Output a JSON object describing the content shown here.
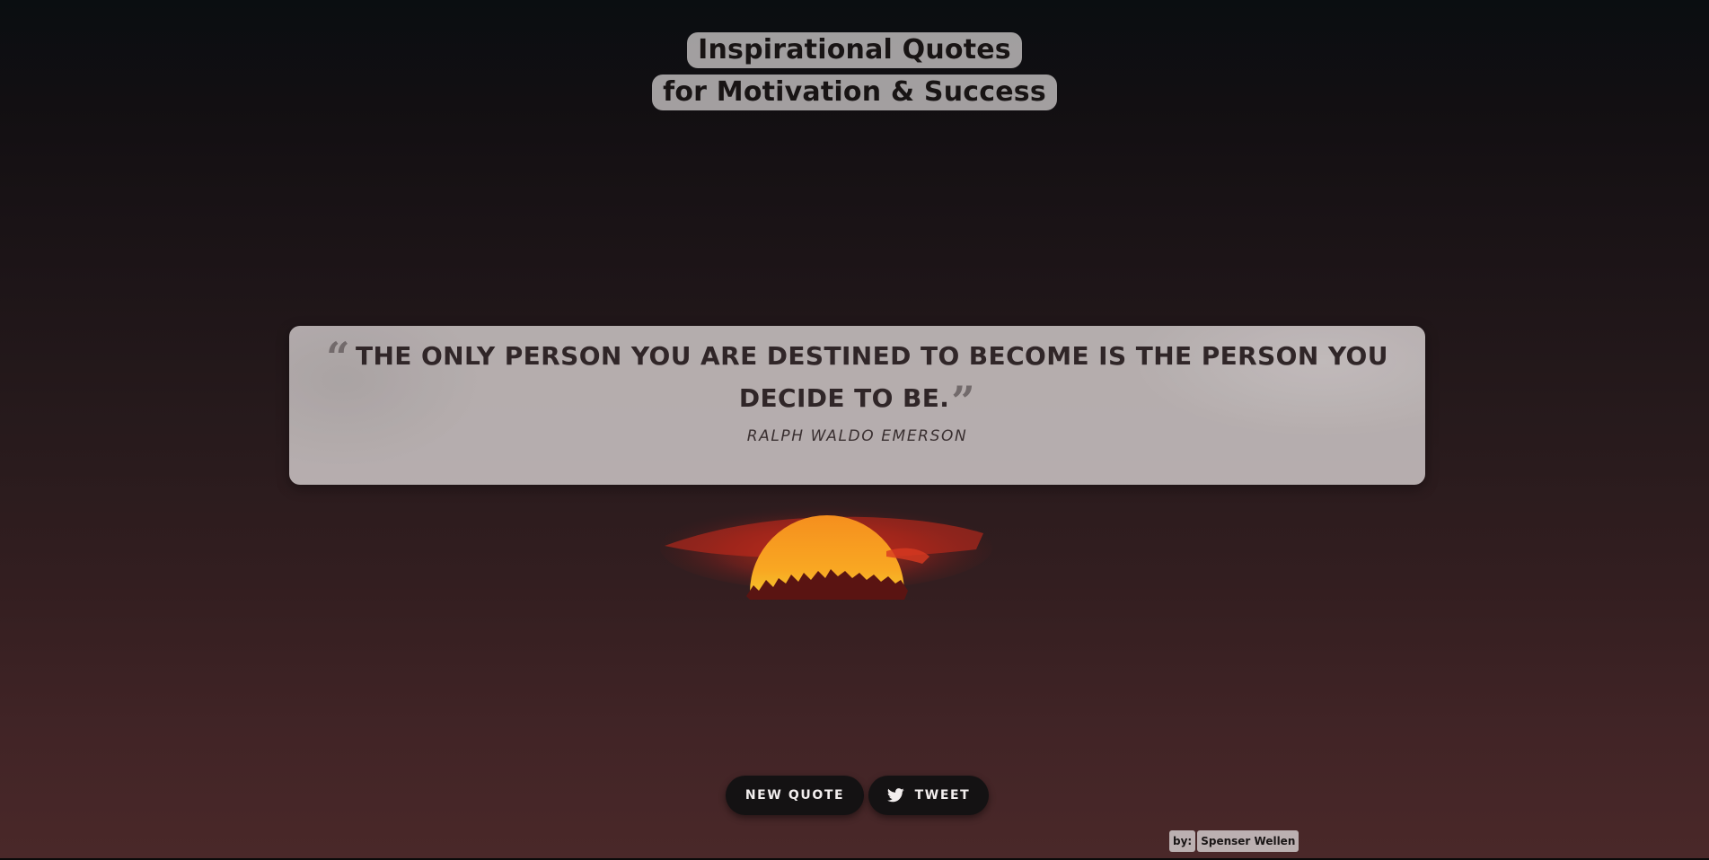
{
  "header": {
    "title_line1": "Inspirational Quotes",
    "title_line2": "for Motivation & Success"
  },
  "quote": {
    "text": "THE ONLY PERSON YOU ARE DESTINED TO BECOME IS THE PERSON YOU DECIDE TO BE.",
    "open_mark": "“",
    "close_mark": "”",
    "author": "RALPH WALDO EMERSON"
  },
  "actions": {
    "new_quote_label": "NEW QUOTE",
    "tweet_label": "TWEET",
    "tweet_icon": "twitter-icon"
  },
  "credit": {
    "prefix": "by:",
    "name": "Spenser Wellen"
  },
  "colors": {
    "background_top": "#0a0e11",
    "background_bottom": "#4a2829",
    "card": "#cdc6c6",
    "button": "#141213",
    "sun": "#f7a21d"
  }
}
